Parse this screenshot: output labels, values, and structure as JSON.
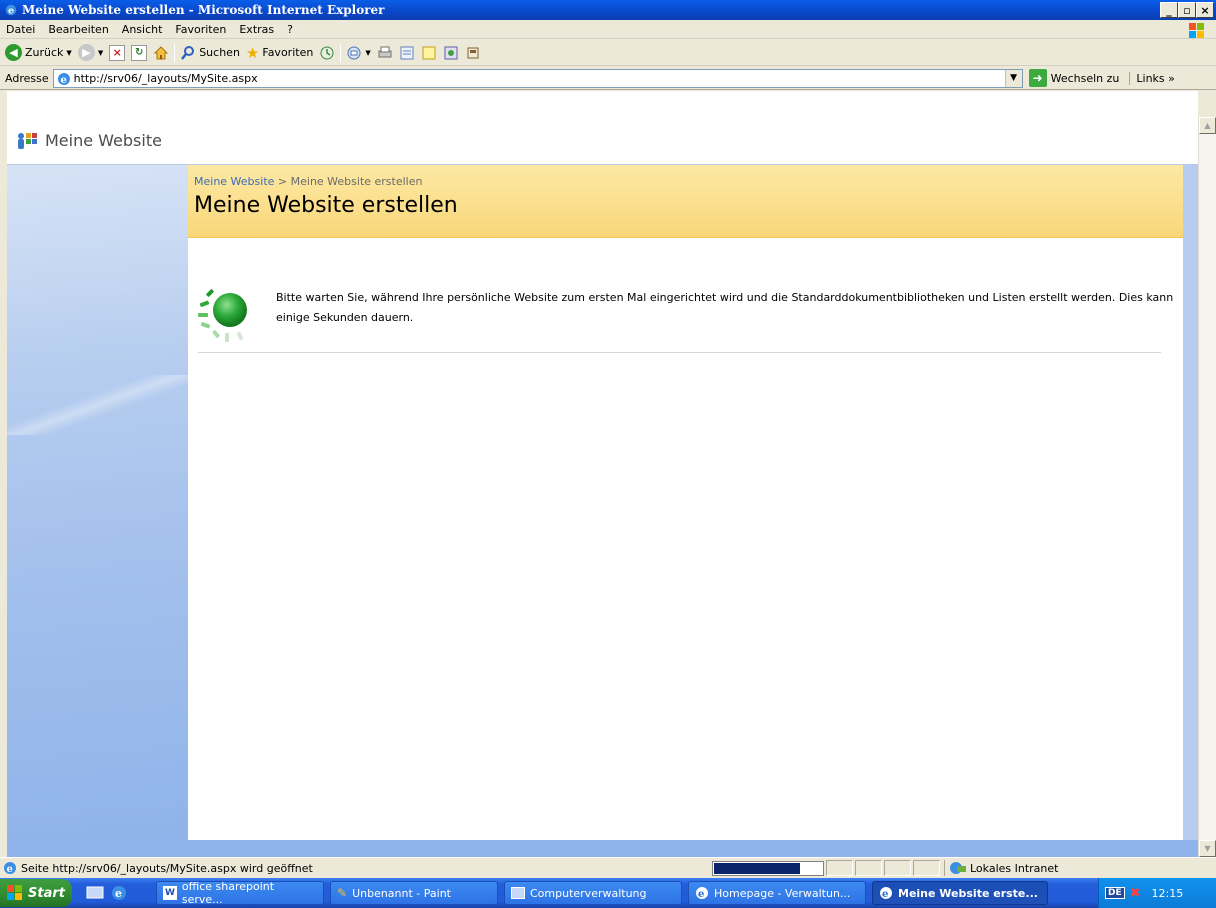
{
  "window": {
    "title": "Meine Website erstellen - Microsoft Internet Explorer",
    "buttons": [
      "_",
      "▫",
      "×"
    ]
  },
  "menu": [
    "Datei",
    "Bearbeiten",
    "Ansicht",
    "Favoriten",
    "Extras",
    "?"
  ],
  "toolbar": {
    "back": "Zurück",
    "search": "Suchen",
    "favorites": "Favoriten"
  },
  "address": {
    "label": "Adresse",
    "url": "http://srv06/_layouts/MySite.aspx",
    "go": "Wechseln zu",
    "links": "Links"
  },
  "sharepoint": {
    "site_title": "Meine Website",
    "breadcrumb": {
      "home": "Meine Website",
      "separator": ">",
      "current": "Meine Website erstellen"
    },
    "page_title": "Meine Website erstellen",
    "wait_message": "Bitte warten Sie, während Ihre persönliche Website zum ersten Mal eingerichtet wird und die Standarddokumentbibliotheken und Listen erstellt werden. Dies kann einige Sekunden dauern."
  },
  "status": {
    "text": "Seite http://srv06/_layouts/MySite.aspx wird geöffnet",
    "progress": 0.8,
    "zone": "Lokales Intranet"
  },
  "taskbar": {
    "start": "Start",
    "tasks": [
      "office sharepoint serve...",
      "Unbenannt - Paint",
      "Computerverwaltung",
      "Homepage - Verwaltun...",
      "Meine Website erste..."
    ],
    "lang": "DE",
    "clock": "12:15"
  },
  "colors": {
    "titlebar": "#0a5ee8",
    "leftnav": "#b6cdef",
    "titlearea": "#f9d779",
    "link": "#3d6bb6"
  }
}
